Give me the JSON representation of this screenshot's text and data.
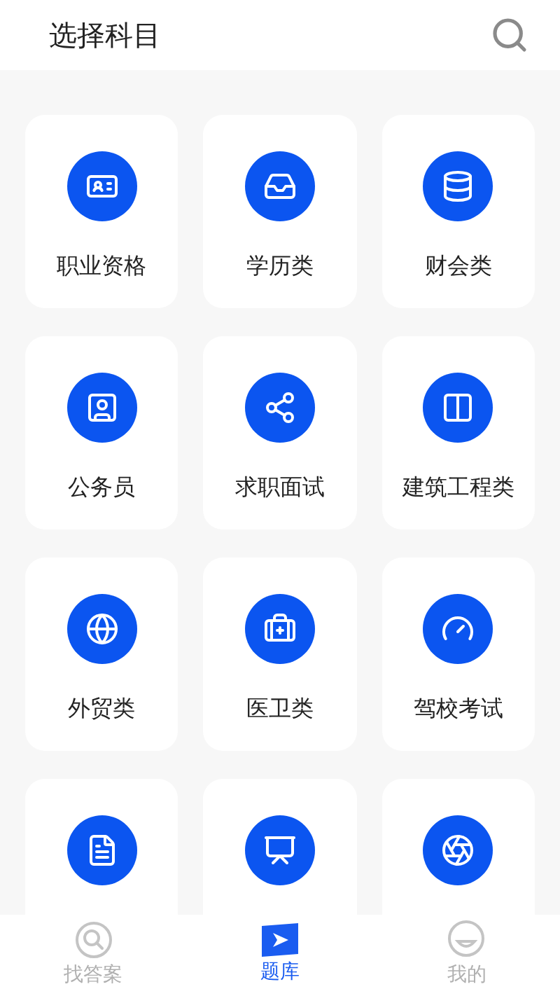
{
  "header": {
    "title": "选择科目"
  },
  "subjects": [
    {
      "kind": "labelled",
      "label": "职业资格"
    },
    {
      "kind": "labelled",
      "label": "学历类"
    },
    {
      "kind": "labelled",
      "label": "财会类"
    },
    {
      "kind": "labelled",
      "label": "公务员"
    },
    {
      "kind": "labelled",
      "label": "求职面试"
    },
    {
      "kind": "labelled",
      "label": "建筑工程类"
    },
    {
      "kind": "labelled",
      "label": "外贸类"
    },
    {
      "kind": "labelled",
      "label": "医卫类"
    },
    {
      "kind": "labelled",
      "label": "驾校考试"
    },
    {
      "kind": "cut_off"
    },
    {
      "kind": "cut_off"
    },
    {
      "kind": "cut_off"
    }
  ],
  "tabs": [
    {
      "label": "找答案",
      "selected": false
    },
    {
      "label": "题库",
      "selected": true
    },
    {
      "label": "我的",
      "selected": false
    }
  ]
}
